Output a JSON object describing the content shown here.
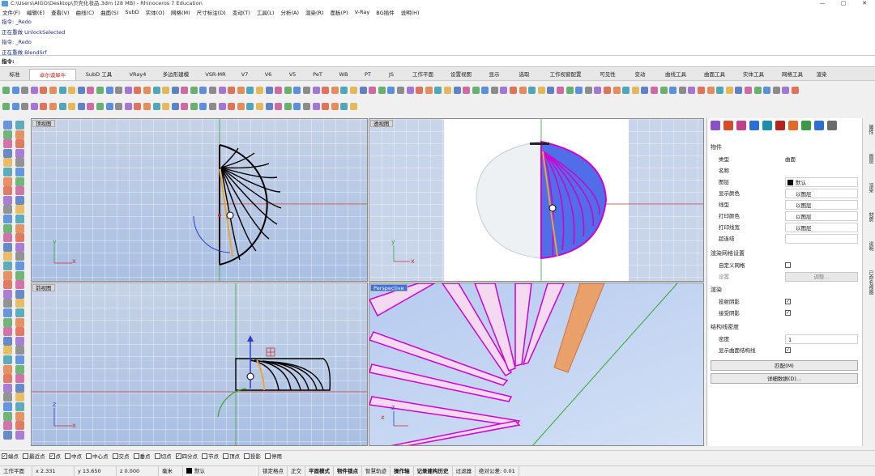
{
  "window": {
    "title": "C:\\Users\\AIGO\\Desktop\\贝壳化妆品.3dm (28 MB) - Rhinoceros 7 Education",
    "minimize": "—",
    "maximize": "▢",
    "close": "✕"
  },
  "menu": [
    "文件(F)",
    "编辑(E)",
    "查看(V)",
    "曲线(C)",
    "曲面(S)",
    "SubD",
    "实体(O)",
    "网格(M)",
    "尺寸标注(D)",
    "变动(T)",
    "工具(L)",
    "分析(A)",
    "渲染(R)",
    "面板(P)",
    "V-Ray",
    "BG插件",
    "说明(H)"
  ],
  "history": [
    "指令: _Redo",
    "正在重做 UnlockSelected",
    "指令: _Redo",
    "正在重做 BlendSrf"
  ],
  "command_prompt": "指令:",
  "tabs": [
    "标准",
    "卓尔谟犀牛",
    "SubD 工具",
    "VRay4",
    "多边形建模",
    "VSR-MR",
    "V7",
    "V6",
    "V5",
    "PeT",
    "WB",
    "PT",
    "JS",
    "工作平面",
    "设置视图",
    "显示",
    "选取",
    "工作视窗配置",
    "可见性",
    "变动",
    "曲线工具",
    "曲面工具",
    "实体工具",
    "网格工具",
    "渲染"
  ],
  "active_tab": "卓尔谟犀牛",
  "viewports": {
    "top": {
      "label": "顶视图",
      "x_axis": "x",
      "y_axis": "y"
    },
    "persp": {
      "label": "透视图",
      "x_axis": "x",
      "y_axis": "y"
    },
    "front": {
      "label": "前视图",
      "x_axis": "x",
      "z_axis": "z"
    },
    "perspective": {
      "label": "Perspective",
      "x_axis": "x",
      "z_axis": "z"
    }
  },
  "panel": {
    "object_section": "物件",
    "rows": [
      {
        "label": "类型",
        "value": "曲面"
      },
      {
        "label": "名称",
        "value": ""
      },
      {
        "label": "图层",
        "value": "默认"
      },
      {
        "label": "显示颜色",
        "value": "以图层"
      },
      {
        "label": "线型",
        "value": "以图层"
      },
      {
        "label": "打印颜色",
        "value": "以图层"
      },
      {
        "label": "打印线宽",
        "value": "以图层"
      },
      {
        "label": "超连结",
        "value": ""
      }
    ],
    "render_mesh_section": "渲染网格设置",
    "custom_mesh_label": "自定义网格",
    "settings_label": "设置",
    "adjust_button": "调整...",
    "render_section": "渲染",
    "cast_shadow_label": "投射阴影",
    "receive_shadow_label": "接受阴影",
    "isocurve_section": "结构线密度",
    "density_label": "密度",
    "density_value": "1",
    "show_isocurves_label": "显示曲面结构线",
    "match_button": "匹配(M)",
    "details_button": "详细数据(D)..."
  },
  "side_tabs": [
    "属性",
    "图层",
    "渲染",
    "材质",
    "说明",
    "已命名视图"
  ],
  "osnaps": [
    {
      "label": "端点",
      "checked": true
    },
    {
      "label": "最近点",
      "checked": false
    },
    {
      "label": "点",
      "checked": true
    },
    {
      "label": "中点",
      "checked": false
    },
    {
      "label": "中心点",
      "checked": false
    },
    {
      "label": "交点",
      "checked": false
    },
    {
      "label": "垂点",
      "checked": false
    },
    {
      "label": "切点",
      "checked": false
    },
    {
      "label": "四分点",
      "checked": true
    },
    {
      "label": "节点",
      "checked": false
    },
    {
      "label": "顶点",
      "checked": false
    },
    {
      "label": "投影",
      "checked": false
    },
    {
      "label": "停用",
      "checked": false
    }
  ],
  "status": {
    "cplane": "工作平面",
    "x": "x 2.331",
    "y": "y 13.650",
    "z": "z 0.000",
    "units": "毫米",
    "layer": "默认",
    "toggles": [
      {
        "label": "锁定格点",
        "on": false
      },
      {
        "label": "正交",
        "on": false
      },
      {
        "label": "平面模式",
        "on": true
      },
      {
        "label": "物件锁点",
        "on": true
      },
      {
        "label": "智慧轨迹",
        "on": false
      },
      {
        "label": "操作轴",
        "on": true
      },
      {
        "label": "记录建构历史",
        "on": true
      },
      {
        "label": "过滤器",
        "on": false
      }
    ],
    "tolerance": "绝对公差: 0.01"
  },
  "colors": {
    "accent_tab": "#b3261e",
    "viewport_top": "#c6d2e6",
    "viewport_bottom": "#a9bfe3",
    "surface_magenta": "#d000d0",
    "surface_blue": "#4f6ee8",
    "curve_orange": "#e9a43a",
    "axis_red": "#c03030",
    "axis_green": "#2eaa2e"
  }
}
